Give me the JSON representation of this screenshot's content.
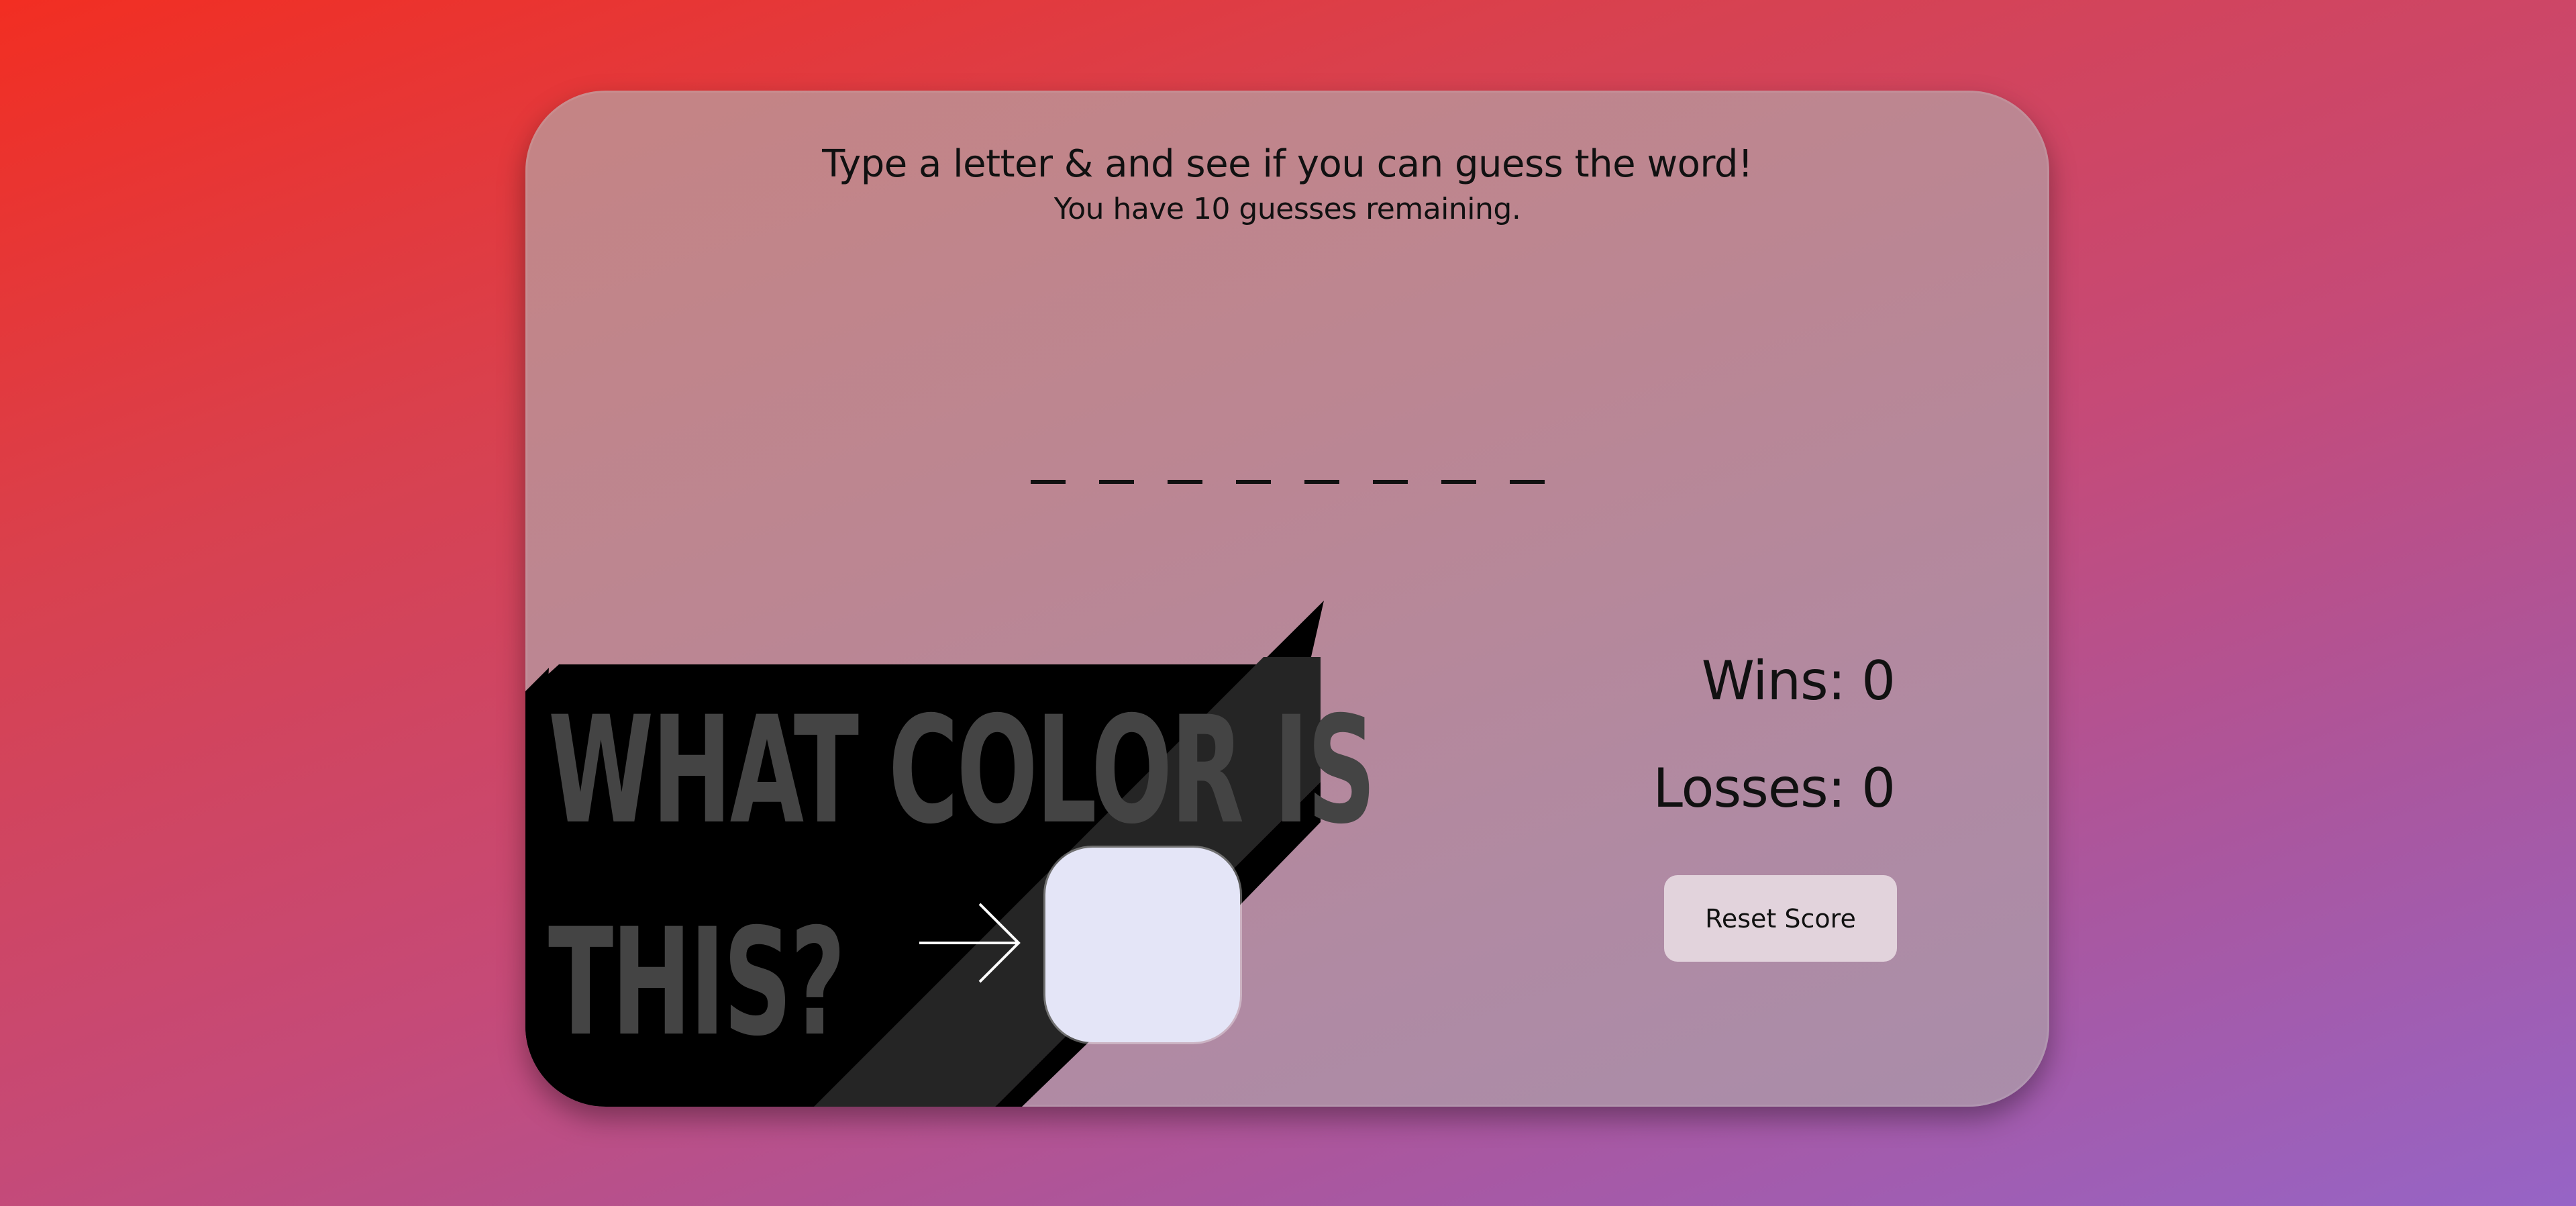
{
  "instructions": {
    "headline": "Type a letter & and see if you can guess the word!",
    "guesses_remaining": "You have 10 guesses remaining."
  },
  "word": {
    "letters": [
      "_",
      "_",
      "_",
      "_",
      "_",
      "_",
      "_",
      "_"
    ]
  },
  "title": {
    "line1": "WHAT COLOR IS",
    "line2": "THIS?"
  },
  "swatch": {
    "color": "#e4e5f7"
  },
  "scores": {
    "wins": "Wins: 0",
    "losses": "Losses: 0"
  },
  "reset": {
    "label": "Reset Score"
  },
  "icons": {
    "arrow": "arrow-right-icon"
  },
  "colors": {
    "background_start": "#f22e22",
    "background_end": "#9664c6",
    "title_text": "#444444",
    "shadow": "#000000"
  }
}
